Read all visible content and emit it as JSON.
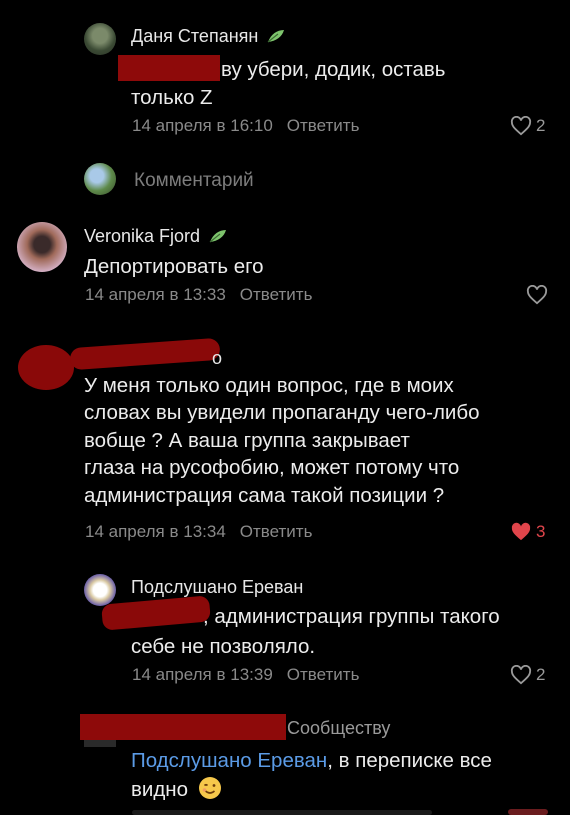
{
  "comments": [
    {
      "author": "Даня Степанян",
      "text_line1": "ву убери, додик, оставь",
      "text_line2": "только Z",
      "date": "14 апреля в 16:10",
      "reply": "Ответить",
      "likes": "2"
    },
    {
      "placeholder": "Комментарий"
    },
    {
      "author": "Veronika Fjord",
      "text": "Депортировать его",
      "date": "14 апреля в 13:33",
      "reply": "Ответить"
    },
    {
      "author_tail": "о",
      "lines": [
        "У меня только один вопрос, где в моих",
        "словах вы увидели пропаганду чего-либо",
        "вобще ? А ваша группа закрывает",
        "глаза на русофобию, может потому что",
        "администрация сама такой позиции ?"
      ],
      "date": "14 апреля в 13:34",
      "reply": "Ответить",
      "likes": "3"
    },
    {
      "author": "Подслушано Ереван",
      "text_line1": ", администрация группы такого",
      "text_line2": "себе не позволяло.",
      "date": "14 апреля в 13:39",
      "reply": "Ответить",
      "likes": "2"
    },
    {
      "author_tail": "Сообществу",
      "mention": "Подслушано Ереван",
      "text_line1_rest": ", в переписке все",
      "text_line2": "видно"
    }
  ],
  "colors": {
    "background": "#000000",
    "like_active": "#e0454b",
    "link": "#5b9be6",
    "redaction": "#8e0a0a"
  }
}
